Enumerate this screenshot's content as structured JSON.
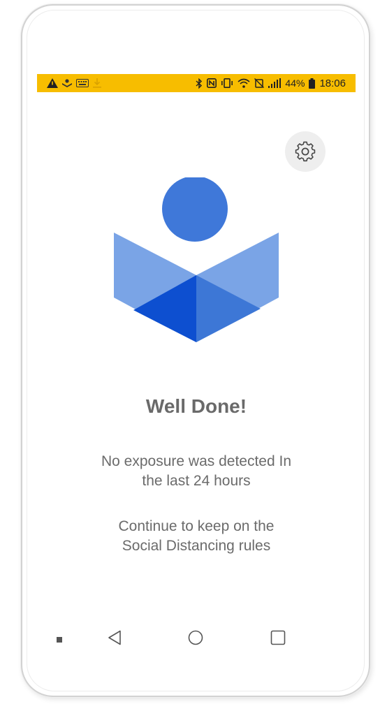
{
  "status_bar": {
    "left_icons": [
      "warning-icon",
      "app-notification-icon",
      "keyboard-icon",
      "download-icon"
    ],
    "right_icons": [
      "bluetooth-icon",
      "nfc-icon",
      "vibrate-icon",
      "wifi-icon",
      "alarm-off-icon",
      "signal-icon",
      "battery-icon"
    ],
    "battery_percent": "44%",
    "time": "18:06",
    "background_color": "#f7bd00"
  },
  "settings_button": {
    "icon": "gear-icon"
  },
  "logo": {
    "icon": "app-logo",
    "colors": {
      "circle": "#3f78d9",
      "light": "#7aa4e6",
      "mid": "#3d77d6",
      "dark": "#0d4fd0"
    }
  },
  "main": {
    "title": "Well Done!",
    "message1": {
      "line1": "No exposure was detected In",
      "line2": "the last 24 hours"
    },
    "message2": {
      "line1": "Continue to keep on the",
      "line2": "Social Distancing rules"
    }
  },
  "nav_bar": {
    "items": [
      "recents-dot-icon",
      "back-icon",
      "home-icon",
      "overview-icon"
    ]
  }
}
